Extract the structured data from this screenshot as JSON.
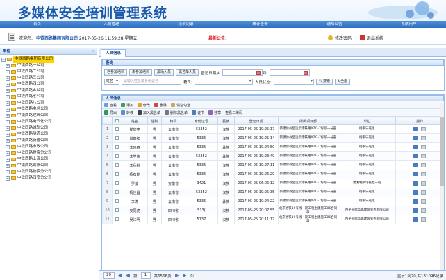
{
  "banner": {
    "title": "多媒体安全培训管理系统"
  },
  "nav": [
    "首页",
    "人员管理",
    "培训记录",
    "统计查询",
    "通知公告",
    "系统用户"
  ],
  "welcome": {
    "prefix": "欢迎您:",
    "company": "中铁西路集团有限公司",
    "datetime": "2017-05-26 11:59:28 星期五",
    "notice": "最新公告:",
    "change_password": "修改密码",
    "logout": "退出系统"
  },
  "sidebar": {
    "title": "单位",
    "collapse": "«",
    "root": "中铁西路集团有限公司",
    "items": [
      "中铁西路一公司",
      "中铁西路二公司",
      "中铁西路三公司",
      "中铁西路四公司",
      "中铁西路五公司",
      "中铁西路七公司",
      "中铁西路八公司",
      "中铁西路电务公司",
      "中铁西路建筑公司",
      "中铁西路电气化公司",
      "中铁西路城轨公司",
      "中铁西路隧道公司",
      "中铁西路新疆公司",
      "中铁西路市政公司",
      "中铁西路投资分公司",
      "中铁西路上海公司",
      "中铁西路勘察公司",
      "中铁西路物资分公司",
      "中铁西路西安分公司"
    ]
  },
  "tab": {
    "label": "人员信息"
  },
  "query": {
    "title": "查询",
    "buttons": [
      "已参加培训",
      "未参加培训",
      "黑场入员",
      "黑名单人员"
    ],
    "reg_date_label": "登记日期从",
    "to_label": "到:",
    "name_select": "姓名",
    "name_placeholder": "请输入姓名或身份证号",
    "origin_label": "籍贯:",
    "status_label": "人员状态:",
    "search_btn": "搜索",
    "all_btn": "全部"
  },
  "person": {
    "title": "人员信息",
    "toolbar1": [
      "查看",
      "添加",
      "修改",
      "删除",
      "请空勾选"
    ],
    "toolbar2": [
      "导出",
      "转移",
      "加入黑名单",
      "删除黑名单",
      "证书",
      "违章",
      "查看二维码"
    ],
    "columns": [
      "姓名",
      "性别",
      "籍贯",
      "身份证号",
      "民族",
      "登记日期",
      "所属项目部",
      "单位",
      "操作"
    ],
    "rows": [
      {
        "n": "1",
        "name": "崔家亮",
        "sex": "男",
        "origin": "云南省",
        "id": "53352",
        "nation": "汉族",
        "date": "2017-05-25 19:25:17",
        "dept": "新建徐州至连云港铁路XZQ-7标段一分部",
        "unit": "杨家乐班组"
      },
      {
        "n": "2",
        "name": "肖康红",
        "sex": "男",
        "origin": "云南省",
        "id": "5335",
        "nation": "汉族",
        "date": "2017-05-25 19:25:14",
        "dept": "新建徐州至连云港铁路XZQ-7标段一分部",
        "unit": "杨家乐班组"
      },
      {
        "n": "3",
        "name": "李晓春",
        "sex": "男",
        "origin": "云南省",
        "id": "5335",
        "nation": "彝族",
        "date": "2017-05-25 19:24:50",
        "dept": "新建徐州至连云港铁路XZQ-7标段一分部",
        "unit": "杨家乐班组"
      },
      {
        "n": "4",
        "name": "李学伟",
        "sex": "男",
        "origin": "云南省",
        "id": "53352",
        "nation": "彝族",
        "date": "2017-05-25 19:28:49",
        "dept": "新建徐州至连云港铁路XZQ-7标段一分部",
        "unit": "杨家乐班组"
      },
      {
        "n": "5",
        "name": "李兵科",
        "sex": "男",
        "origin": "云南省",
        "id": "5335",
        "nation": "汉族",
        "date": "2017-05-25 19:27:11",
        "dept": "新建徐州至连云港铁路XZQ-7标段一分部",
        "unit": "杨家乐班组"
      },
      {
        "n": "6",
        "name": "杨石能",
        "sex": "男",
        "origin": "云南省",
        "id": "5335",
        "nation": "汉族",
        "date": "2017-05-25 19:26:29",
        "dept": "新建徐州至连云港铁路XZQ-7标段一分部",
        "unit": "杨家乐班组"
      },
      {
        "n": "7",
        "name": "罗凌",
        "sex": "男",
        "origin": "安徽省",
        "id": "3421",
        "nation": "汉族",
        "date": "2017-05-25 06:06:12",
        "dept": "新建徐州至连云港铁路XZQ-7标段一分部",
        "unit": "建湘制梁场张杜一班"
      },
      {
        "n": "8",
        "name": "杨佳昌",
        "sex": "男",
        "origin": "云南省",
        "id": "53352",
        "nation": "汉族",
        "date": "2017-05-25 19:25:35",
        "dept": "新建徐州至连云港铁路XZQ-7标段一分部",
        "unit": "杨家乐班组"
      },
      {
        "n": "9",
        "name": "李涛",
        "sex": "男",
        "origin": "云南省",
        "id": "5335",
        "nation": "彝族",
        "date": "2017-05-25 19:24:22",
        "dept": "新建徐州至连云港铁路XZQ-7标段一分部",
        "unit": "杨家乐班组"
      },
      {
        "n": "10",
        "name": "安同虎",
        "sex": "男",
        "origin": "四川省",
        "id": "513(",
        "nation": "汉族",
        "date": "2017-05-25 20:07:55",
        "dept": "北京地铁19号线一期工程土建施工06合同段",
        "unit": "西平县鼎华路建筑劳务有限公司"
      },
      {
        "n": "11",
        "name": "吴江明",
        "sex": "男",
        "origin": "四川省",
        "id": "5137",
        "nation": "汉族",
        "date": "2017-05-25 20:11:17",
        "dept": "北京地铁19号线一期工程土建施工06合同段",
        "unit": "西平县鼎华路建筑劳务有限公司"
      }
    ]
  },
  "pager": {
    "page_size": "20",
    "page_label_pre": "第",
    "page_value": "1",
    "page_label_post": "共6566页",
    "display": "显示1到20,共131096记录"
  }
}
